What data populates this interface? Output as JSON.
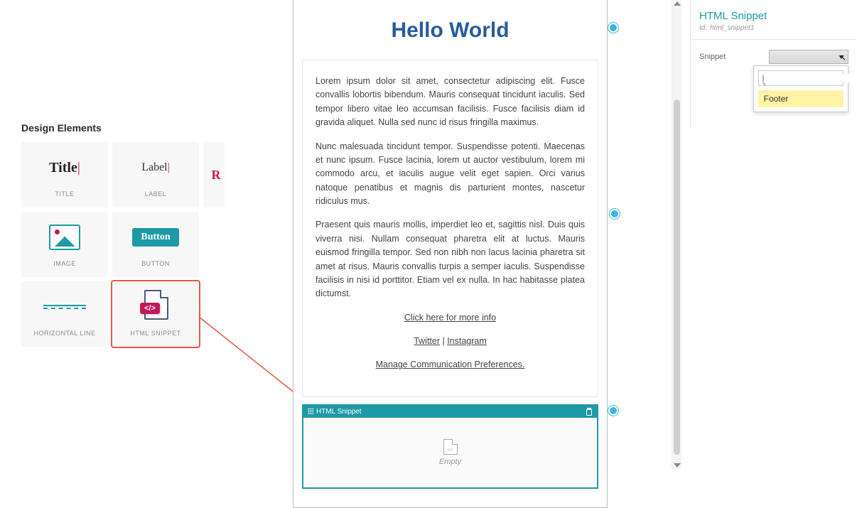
{
  "design": {
    "heading": "Design Elements",
    "tiles": {
      "title": {
        "visual": "Title",
        "label": "TITLE"
      },
      "label": {
        "visual": "Label",
        "label": "LABEL"
      },
      "rich": {
        "visual": "R"
      },
      "image": {
        "label": "IMAGE"
      },
      "button": {
        "visual": "Button",
        "label": "BUTTON"
      },
      "hline": {
        "label": "HORIZONTAL LINE"
      },
      "snippet": {
        "label": "HTML SNIPPET"
      }
    }
  },
  "canvas": {
    "hero": "Hello World",
    "p1": "Lorem ipsum dolor sit amet, consectetur adipiscing elit. Fusce convallis lobortis bibendum. Mauris consequat tincidunt iaculis. Sed tempor libero vitae leo accumsan facilisis. Fusce facilisis diam id gravida aliquet. Nulla sed nunc id risus fringilla maximus.",
    "p2": "Nunc malesuada tincidunt tempor. Suspendisse potenti. Maecenas et nunc ipsum. Fusce lacinia, lorem ut auctor vestibulum, lorem mi commodo arcu, et iaculis augue velit eget sapien. Orci varius natoque penatibus et magnis dis parturient montes, nascetur ridiculus mus.",
    "p3": "Praesent quis mauris mollis, imperdiet leo et, sagittis nisl. Duis quis viverra nisi. Nullam consequat pharetra elit at luctus. Mauris euismod fringilla tempor. Sed non nibh non lacus lacinia pharetra sit amet at risus. Mauris convallis turpis a semper iaculis. Suspendisse facilisis in nisi id porttitor. Etiam vel ex nulla. In hac habitasse platea dictumst.",
    "link_more": "Click here for more info",
    "link_twitter": "Twitter",
    "link_sep": " | ",
    "link_instagram": "Instagram",
    "link_prefs": "Manage Communication Preferences.",
    "snippet": {
      "header": "HTML Snippet",
      "body": "Empty"
    }
  },
  "props": {
    "title": "HTML Snippet",
    "id_label": "Id:",
    "id_value": "html_snippet1",
    "field_label": "Snippet",
    "search_placeholder": "",
    "search_value": "",
    "option_footer": "Footer"
  }
}
